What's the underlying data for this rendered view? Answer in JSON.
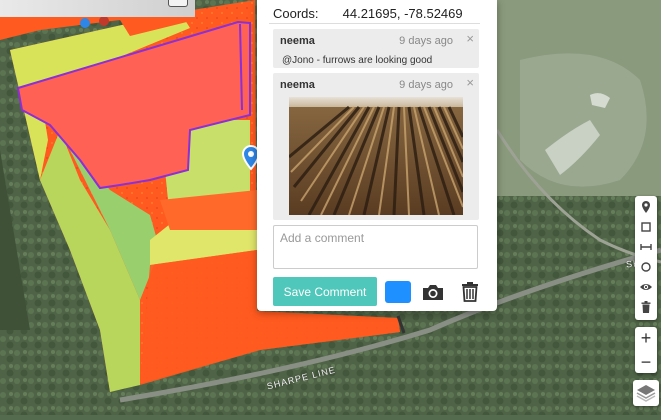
{
  "popup": {
    "coords_label": "Coords:",
    "coords_value": "44.21695, -78.52469",
    "comments": [
      {
        "author": "neema",
        "time": "9 days ago",
        "text": "@Jono - furrows are looking good"
      },
      {
        "author": "neema",
        "time": "9 days ago",
        "text": ""
      }
    ],
    "close_glyph": "×",
    "comment_placeholder": "Add a comment",
    "save_label": "Save Comment",
    "color_swatch": "#1e90ff"
  },
  "map": {
    "road_label": "SHARPE LINE",
    "colors": {
      "field_red": "#ff5a1f",
      "zone_red": "#ff6155",
      "boundary": "#8b2fd6",
      "marker": "#2e86e6"
    }
  },
  "toolbar": {
    "tools": [
      "marker-icon",
      "square-icon",
      "measure-icon",
      "circle-icon",
      "eye-icon",
      "trash-icon"
    ]
  },
  "zoom": {
    "in_label": "+",
    "out_label": "−"
  }
}
